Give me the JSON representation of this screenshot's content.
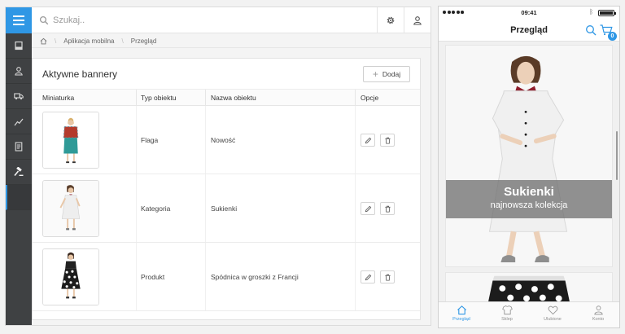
{
  "admin": {
    "search": {
      "placeholder": "Szukaj.."
    },
    "breadcrumb": [
      "Aplikacja mobilna",
      "Przegląd"
    ],
    "card": {
      "title": "Aktywne bannery",
      "add_label": "Dodaj",
      "columns": [
        "Miniaturka",
        "Typ obiektu",
        "Nazwa obiektu",
        "Opcje"
      ],
      "rows": [
        {
          "type": "Flaga",
          "name": "Nowość"
        },
        {
          "type": "Kategoria",
          "name": "Sukienki"
        },
        {
          "type": "Produkt",
          "name": "Spódnica w groszki z Francji"
        }
      ]
    },
    "sidebar_icons": [
      "receipt-icon",
      "user-icon",
      "truck-icon",
      "chart-icon",
      "document-icon",
      "gavel-icon"
    ],
    "accent": "#2f97e5"
  },
  "phone": {
    "status": {
      "time": "09:41"
    },
    "title": "Przegląd",
    "cart_count": "0",
    "banner": {
      "title": "Sukienki",
      "subtitle": "najnowsza kolekcja"
    },
    "tabs": [
      "Przegląd",
      "Sklep",
      "Ulubione",
      "Konto"
    ]
  }
}
